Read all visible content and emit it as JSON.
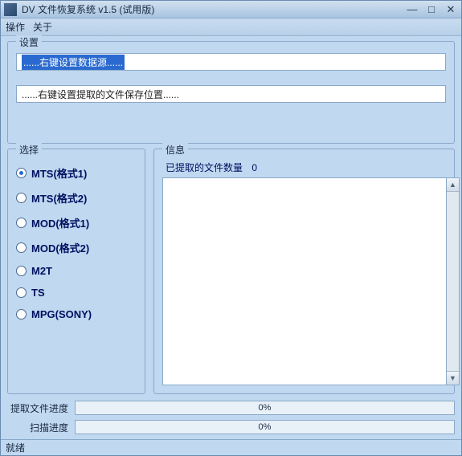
{
  "title": "DV 文件恢复系统 v1.5 (试用版)",
  "menu": {
    "action": "操作",
    "about": "关于"
  },
  "settings": {
    "legend": "设置",
    "source": "......右键设置数据源......",
    "savepath": "......右键设置提取的文件保存位置......"
  },
  "select": {
    "legend": "选择",
    "options": [
      {
        "label": "MTS(格式1)",
        "checked": true
      },
      {
        "label": "MTS(格式2)",
        "checked": false
      },
      {
        "label": "MOD(格式1)",
        "checked": false
      },
      {
        "label": "MOD(格式2)",
        "checked": false
      },
      {
        "label": "M2T",
        "checked": false
      },
      {
        "label": "TS",
        "checked": false
      },
      {
        "label": "MPG(SONY)",
        "checked": false
      }
    ]
  },
  "info": {
    "legend": "信息",
    "extracted_label": "已提取的文件数量",
    "extracted_count": "0"
  },
  "progress": {
    "extract_label": "提取文件进度",
    "scan_label": "扫描进度",
    "extract_pct": "0%",
    "scan_pct": "0%"
  },
  "status": "就绪"
}
